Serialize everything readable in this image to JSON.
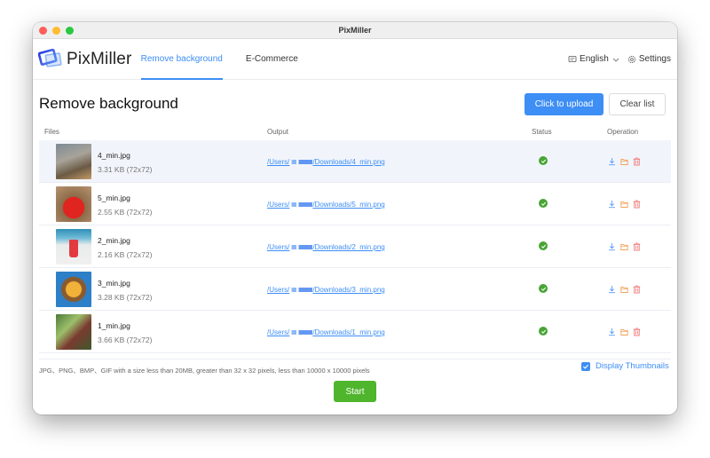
{
  "window": {
    "title": "PixMiller"
  },
  "nav": {
    "logo_text": "PixMiller",
    "tabs": [
      {
        "label": "Remove background",
        "active": true
      },
      {
        "label": "E-Commerce",
        "active": false
      }
    ],
    "language": {
      "icon": "message-square-icon",
      "label": "English"
    },
    "settings": {
      "icon": "gear-icon",
      "label": "Settings"
    }
  },
  "page": {
    "title": "Remove background",
    "upload_button": "Click to upload",
    "clear_button": "Clear list"
  },
  "table": {
    "columns": {
      "files": "Files",
      "output": "Output",
      "status": "Status",
      "operation": "Operation"
    },
    "rows": [
      {
        "name": "4_min.jpg",
        "size": "3.31 KB (72x72)",
        "output_prefix": "/Users/",
        "output_suffix": "/Downloads/4_min.png",
        "status": "success",
        "highlighted": true
      },
      {
        "name": "5_min.jpg",
        "size": "2.55 KB (72x72)",
        "output_prefix": "/Users/",
        "output_suffix": "/Downloads/5_min.png",
        "status": "success",
        "highlighted": false
      },
      {
        "name": "2_min.jpg",
        "size": "2.16 KB (72x72)",
        "output_prefix": "/Users/",
        "output_suffix": "/Downloads/2_min.png",
        "status": "success",
        "highlighted": false
      },
      {
        "name": "3_min.jpg",
        "size": "3.28 KB (72x72)",
        "output_prefix": "/Users/",
        "output_suffix": "/Downloads/3_min.png",
        "status": "success",
        "highlighted": false
      },
      {
        "name": "1_min.jpg",
        "size": "3.66 KB (72x72)",
        "output_prefix": "/Users/",
        "output_suffix": "/Downloads/1_min.png",
        "status": "success",
        "highlighted": false
      }
    ]
  },
  "footer": {
    "hint": "JPG、PNG、BMP、GIF with a size less than 20MB, greater than 32 x 32 pixels, less than 10000 x 10000 pixels",
    "display_thumbnails": {
      "label": "Display Thumbnails",
      "checked": true
    },
    "start_button": "Start"
  },
  "colors": {
    "accent": "#3d8ef5",
    "success": "#48a535",
    "start": "#4fb52d",
    "folder": "#f0a35a",
    "delete": "#f07070"
  }
}
